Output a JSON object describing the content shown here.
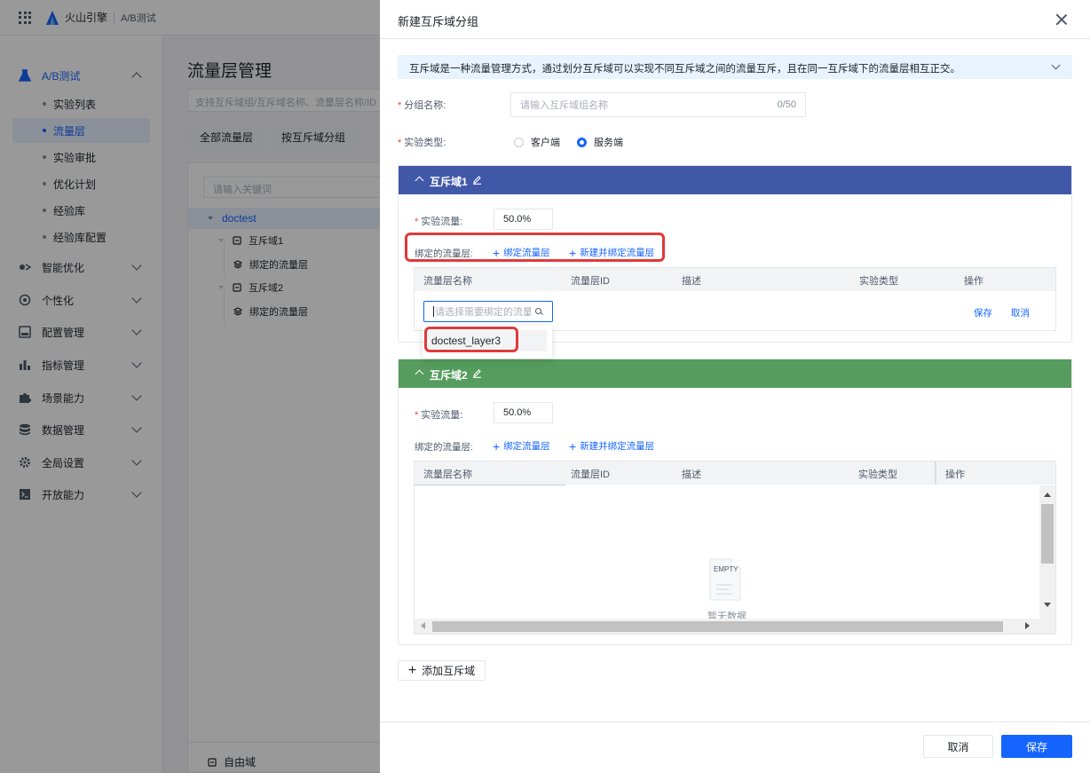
{
  "app": {
    "brand": "火山引擎",
    "product": "A/B测试"
  },
  "sidebar": {
    "groups": [
      {
        "label": "A/B测试",
        "icon": "flask-icon"
      },
      {
        "label": "智能优化",
        "icon": "smart-icon"
      },
      {
        "label": "个性化",
        "icon": "target-icon"
      },
      {
        "label": "配置管理",
        "icon": "config-icon"
      },
      {
        "label": "指标管理",
        "icon": "bar-chart-icon"
      },
      {
        "label": "场景能力",
        "icon": "puzzle-icon"
      },
      {
        "label": "数据管理",
        "icon": "database-icon"
      },
      {
        "label": "全局设置",
        "icon": "gear-icon"
      },
      {
        "label": "开放能力",
        "icon": "terminal-icon"
      }
    ],
    "sub_items": [
      "实验列表",
      "流量层",
      "实验审批",
      "优化计划",
      "经验库",
      "经验库配置"
    ]
  },
  "main": {
    "title": "流量层管理",
    "search_placeholder": "支持互斥域组/互斥域名称、流量层名称/ID",
    "tabs": [
      "全部流量层",
      "按互斥域分组"
    ],
    "tree_search_placeholder": "请输入关键词",
    "tree": {
      "root": "doctest",
      "nodes": [
        "互斥域1",
        "绑定的流量层",
        "互斥域2",
        "绑定的流量层"
      ],
      "footer": "自由域"
    }
  },
  "drawer": {
    "title": "新建互斥域分组",
    "info": "互斥域是一种流量管理方式，通过划分互斥域可以实现不同互斥域之间的流量互斥，且在同一互斥域下的流量层相互正交。",
    "group_name": {
      "label": "分组名称:",
      "placeholder": "请输入互斥域组名称",
      "counter": "0/50"
    },
    "exp_type": {
      "label": "实验类型:",
      "options": [
        "客户端",
        "服务端"
      ],
      "selected": "服务端"
    },
    "domains": [
      {
        "title": "互斥域1",
        "header_color": "#4157a8",
        "traffic_label": "实验流量:",
        "traffic_value": "50.0%",
        "bound_label": "绑定的流量层:",
        "bind_link": "绑定流量层",
        "create_link": "新建并绑定流量层",
        "columns": [
          "流量层名称",
          "流量层ID",
          "描述",
          "实验类型",
          "操作"
        ],
        "select_placeholder": "请选择需要绑定的流量层",
        "save": "保存",
        "cancel": "取消",
        "dropdown_option": "doctest_layer3"
      },
      {
        "title": "互斥域2",
        "header_color": "#559c5e",
        "traffic_label": "实验流量:",
        "traffic_value": "50.0%",
        "bound_label": "绑定的流量层:",
        "bind_link": "绑定流量层",
        "create_link": "新建并绑定流量层",
        "columns": [
          "流量层名称",
          "流量层ID",
          "描述",
          "实验类型",
          "操作"
        ],
        "empty_tag": "EMPTY",
        "empty_text": "暂无数据"
      }
    ],
    "add_domain": "添加互斥域",
    "cancel": "取消",
    "save": "保存"
  }
}
